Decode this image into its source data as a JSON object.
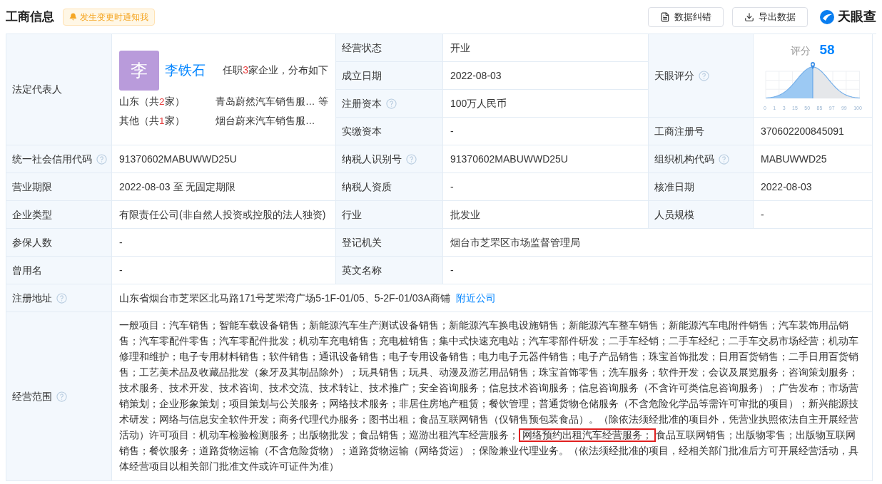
{
  "header": {
    "title": "工商信息",
    "notify_button": "发生变更时通知我",
    "actions": [
      {
        "kind": "report",
        "label": "数据纠错"
      },
      {
        "kind": "export",
        "label": "导出数据"
      }
    ],
    "logo": "天眼查"
  },
  "legal_rep": {
    "label": "法定代表人",
    "avatar": "李",
    "name": "李铁石",
    "summary": {
      "before": "任职",
      "count": "3",
      "after": "家企业，分布如下"
    },
    "regions": [
      {
        "region": "山东（共",
        "count": "2",
        "unit": "家）",
        "company": "青岛蔚然汽车销售服…",
        "more": "等"
      },
      {
        "region": "其他（共",
        "count": "1",
        "unit": "家）",
        "company": "烟台蔚来汽车销售服…"
      }
    ]
  },
  "top_rows": [
    {
      "label": "经营状态",
      "value": "开业",
      "help": false
    },
    {
      "label": "成立日期",
      "value": "2022-08-03",
      "help": false
    },
    {
      "label": "注册资本",
      "value": "100万人民币",
      "help": true
    },
    {
      "label": "实缴资本",
      "value": "-",
      "help": false
    }
  ],
  "score": {
    "label": "天眼评分",
    "help": true,
    "caption": "评分",
    "value": "58",
    "ticks": [
      "0",
      "1",
      "3",
      "15",
      "50",
      "85",
      "97",
      "99",
      "100"
    ]
  },
  "reg_number": {
    "label": "工商注册号",
    "value": "370602200845091",
    "help": false
  },
  "rows": [
    [
      {
        "label": "统一社会信用代码",
        "value": "91370602MABUWWD25U",
        "help": true
      },
      {
        "label": "纳税人识别号",
        "value": "91370602MABUWWD25U",
        "help": true
      },
      {
        "label": "组织机构代码",
        "value": "MABUWWD25",
        "help": true
      }
    ],
    [
      {
        "label": "营业期限",
        "value": "2022-08-03 至 无固定期限",
        "help": false
      },
      {
        "label": "纳税人资质",
        "value": "-",
        "help": false
      },
      {
        "label": "核准日期",
        "value": "2022-08-03",
        "help": false
      }
    ],
    [
      {
        "label": "企业类型",
        "value": "有限责任公司(非自然人投资或控股的法人独资)",
        "help": false
      },
      {
        "label": "行业",
        "value": "批发业",
        "help": false
      },
      {
        "label": "人员规模",
        "value": "-",
        "help": false
      }
    ],
    [
      {
        "label": "参保人数",
        "value": "-",
        "help": false
      },
      {
        "label": "登记机关",
        "value": "烟台市芝罘区市场监督管理局",
        "help": false
      }
    ],
    [
      {
        "label": "曾用名",
        "value": "-",
        "help": false
      },
      {
        "label": "英文名称",
        "value": "-",
        "help": false
      }
    ]
  ],
  "address": {
    "label": "注册地址",
    "help": true,
    "value": "山东省烟台市芝罘区北马路171号芝罘湾广场5-1F-01/05、5-2F-01/03A商铺",
    "link": "附近公司"
  },
  "scope": {
    "label": "经营范围",
    "help": true,
    "before": "一般项目：汽车销售；智能车载设备销售；新能源汽车生产测试设备销售；新能源汽车换电设施销售；新能源汽车整车销售；新能源汽车电附件销售；汽车装饰用品销售；汽车零配件零售；汽车零配件批发；机动车充电销售；充电桩销售；集中式快速充电站；汽车零部件研发；二手车经销；二手车经纪；二手车交易市场经营；机动车修理和维护；电子专用材料销售；软件销售；通讯设备销售；电子专用设备销售；电力电子元器件销售；电子产品销售；珠宝首饰批发；日用百货销售；二手日用百货销售；工艺美术品及收藏品批发（象牙及其制品除外）；玩具销售；玩具、动漫及游艺用品销售；珠宝首饰零售；洗车服务；软件开发；会议及展览服务；咨询策划服务；技术服务、技术开发、技术咨询、技术交流、技术转让、技术推广；安全咨询服务；信息技术咨询服务；信息咨询服务（不含许可类信息咨询服务）；广告发布；市场营销策划；企业形象策划；项目策划与公关服务；网络技术服务；非居住房地产租赁；餐饮管理；普通货物仓储服务（不含危险化学品等需许可审批的项目）；新兴能源技术研发；网络与信息安全软件开发；商务代理代办服务；图书出租；食品互联网销售（仅销售预包装食品）。（除依法须经批准的项目外，凭营业执照依法自主开展经营活动）许可项目：机动车检验检测服务；出版物批发；食品销售；巡游出租汽车经营服务；",
    "highlighted": "网络预约出租汽车经营服务；",
    "after": "食品互联网销售；出版物零售；出版物互联网销售；餐饮服务；道路货物运输（不含危险货物）；道路货物运输（网络货运）；保险兼业代理业务。（依法须经批准的项目，经相关部门批准后方可开展经营活动，具体经营项目以相关部门批准文件或许可证件为准）"
  }
}
